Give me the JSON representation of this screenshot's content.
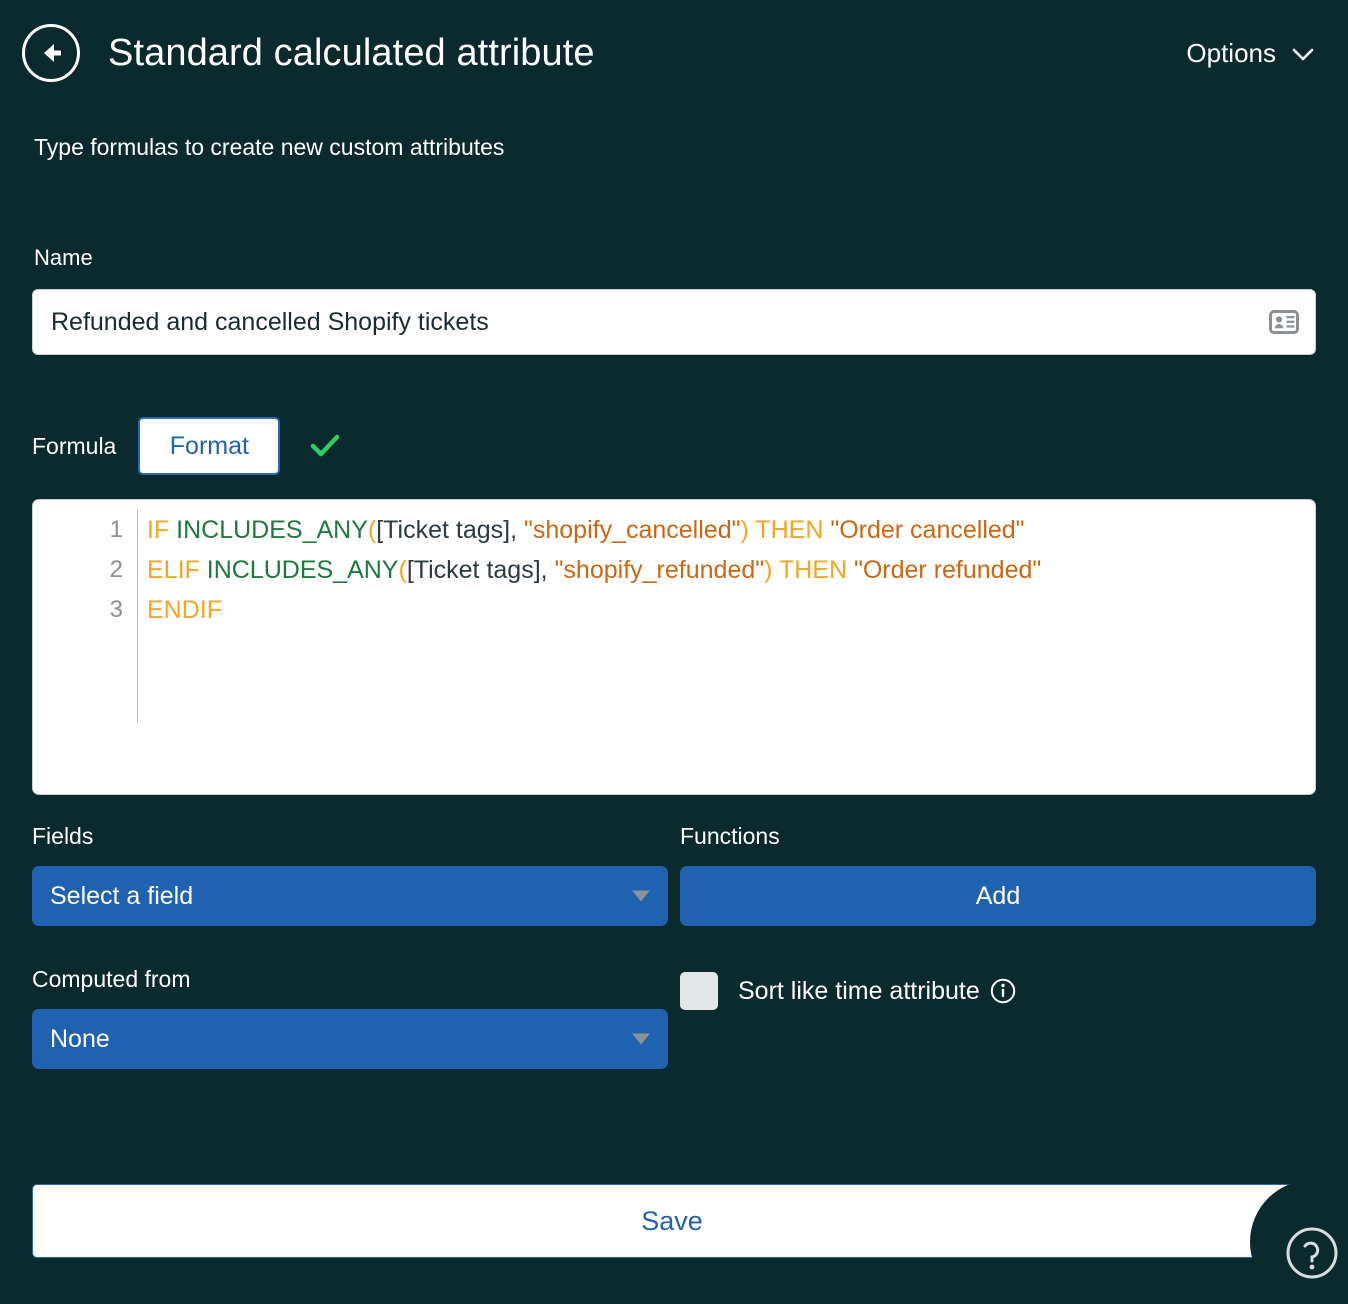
{
  "header": {
    "back_icon": "arrow-left-circle-icon",
    "title": "Standard calculated attribute",
    "options_label": "Options",
    "options_chevron": "chevron-down-icon"
  },
  "subtitle": "Type formulas to create new custom attributes",
  "name_section": {
    "label": "Name",
    "value": "Refunded and cancelled Shopify tickets",
    "placeholder": "Name",
    "icon": "contact-card-icon"
  },
  "formula_section": {
    "label": "Formula",
    "format_button": "Format",
    "status_icon": "check-mark-icon",
    "status_color": "#2ecc61",
    "lines": [
      {
        "number": "1",
        "tokens": [
          {
            "t": "IF",
            "c": "kw"
          },
          {
            "t": " ",
            "c": "punc"
          },
          {
            "t": "INCLUDES_ANY",
            "c": "fn"
          },
          {
            "t": "(",
            "c": "paren"
          },
          {
            "t": "[Ticket tags]",
            "c": "field"
          },
          {
            "t": ", ",
            "c": "punc"
          },
          {
            "t": "\"shopify_cancelled\"",
            "c": "str"
          },
          {
            "t": ")",
            "c": "paren"
          },
          {
            "t": " ",
            "c": "punc"
          },
          {
            "t": "THEN",
            "c": "kw"
          },
          {
            "t": " ",
            "c": "punc"
          },
          {
            "t": "\"Order cancelled\"",
            "c": "str"
          }
        ]
      },
      {
        "number": "2",
        "tokens": [
          {
            "t": "ELIF",
            "c": "kw"
          },
          {
            "t": " ",
            "c": "punc"
          },
          {
            "t": "INCLUDES_ANY",
            "c": "fn"
          },
          {
            "t": "(",
            "c": "paren"
          },
          {
            "t": "[Ticket tags]",
            "c": "field"
          },
          {
            "t": ", ",
            "c": "punc"
          },
          {
            "t": "\"shopify_refunded\"",
            "c": "str"
          },
          {
            "t": ")",
            "c": "paren"
          },
          {
            "t": " ",
            "c": "punc"
          },
          {
            "t": "THEN",
            "c": "kw"
          },
          {
            "t": " ",
            "c": "punc"
          },
          {
            "t": "\"Order refunded\"",
            "c": "str"
          }
        ]
      },
      {
        "number": "3",
        "tokens": [
          {
            "t": "ENDIF",
            "c": "kw"
          }
        ]
      }
    ]
  },
  "fields_section": {
    "label": "Fields",
    "selected": "Select a field",
    "caret_icon": "caret-down-icon"
  },
  "functions_section": {
    "label": "Functions",
    "add_button": "Add"
  },
  "computed_from_section": {
    "label": "Computed from",
    "selected": "None",
    "caret_icon": "caret-down-icon"
  },
  "sort_option": {
    "label": "Sort like time attribute",
    "checked": false,
    "info_icon": "info-circle-icon"
  },
  "save_button": "Save",
  "help_widget": {
    "icon": "help-circle-icon"
  },
  "colors": {
    "background": "#0b2a2e",
    "accent_blue": "#1f62b0",
    "keyword_orange": "#f5a623",
    "function_green": "#1c7a3e",
    "string_orange": "#cc6611",
    "check_green": "#2ecc61"
  }
}
